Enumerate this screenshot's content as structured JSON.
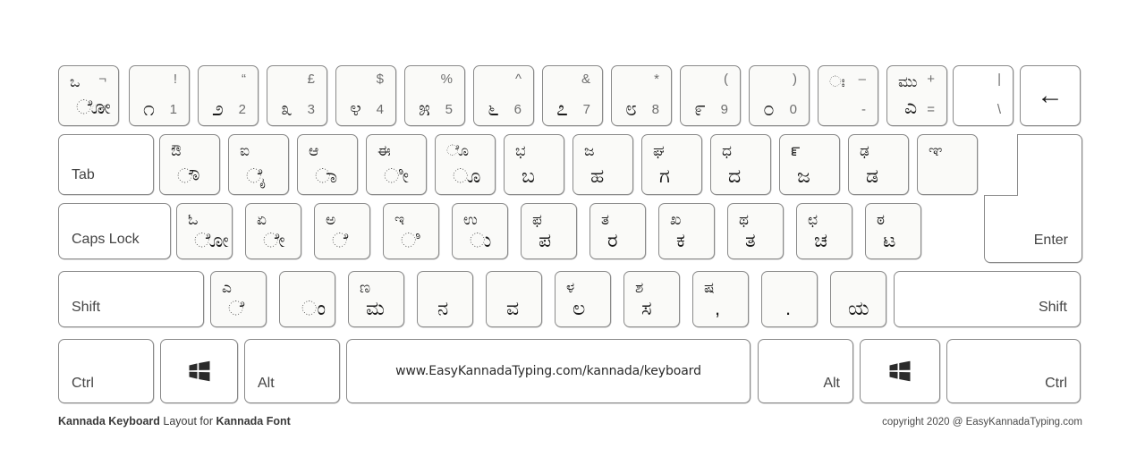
{
  "page": {
    "title": "Kannada Keyboard Layout for Kannada Font",
    "footer_left_strong1": "Kannada Keyboard",
    "footer_left_normal": " Layout for ",
    "footer_left_strong2": "Kannada Font",
    "footer_right": "copyright 2020 @ EasyKannadaTyping.com",
    "background": "#ffffff",
    "key_face": "#fafaf8",
    "key_border": "#8a8a8a",
    "glyph_color": "#1b1b1b",
    "symbol_color": "#6e6e6e"
  },
  "spacebar": {
    "label": "www.EasyKannadaTyping.com/kannada/keyboard"
  },
  "rows": {
    "number_row": [
      {
        "name": "key-backquote",
        "tl": "ಒ",
        "tr": "¬",
        "bl": "ೋ",
        "br": "್"
      },
      {
        "name": "key-1",
        "tr": "!",
        "numglyph": "೧",
        "br": "1"
      },
      {
        "name": "key-2",
        "tr": "“",
        "numglyph": "೨",
        "br": "2"
      },
      {
        "name": "key-3",
        "tr": "£",
        "numglyph": "೩",
        "br": "3"
      },
      {
        "name": "key-4",
        "tr": "$",
        "numglyph": "೪",
        "br": "4"
      },
      {
        "name": "key-5",
        "tr": "%",
        "numglyph": "೫",
        "br": "5"
      },
      {
        "name": "key-6",
        "tr": "^",
        "numglyph": "೬",
        "br": "6"
      },
      {
        "name": "key-7",
        "tr": "&",
        "numglyph": "೭",
        "br": "7"
      },
      {
        "name": "key-8",
        "tr": "*",
        "numglyph": "೮",
        "br": "8"
      },
      {
        "name": "key-9",
        "tr": "(",
        "numglyph": "೯",
        "br": "9"
      },
      {
        "name": "key-0",
        "tr": ")",
        "numglyph": "೦",
        "br": "0"
      },
      {
        "name": "key-minus",
        "tl": "ಃ",
        "tr": "–",
        "bl": "",
        "br": "-"
      },
      {
        "name": "key-equal",
        "tl": "ಮು",
        "tr": "+",
        "bl": "ಎ",
        "br": "="
      },
      {
        "name": "key-backslash",
        "tr": "|",
        "br": "\\"
      },
      {
        "name": "key-backspace",
        "icon": "backspace-arrow",
        "glyph": "←"
      }
    ],
    "tab_row": [
      {
        "name": "key-tab",
        "text": "Tab"
      },
      {
        "name": "key-q",
        "tl": "ಔ",
        "bl": "ೌ"
      },
      {
        "name": "key-w",
        "tl": "ಐ",
        "bl": "ೈ"
      },
      {
        "name": "key-e",
        "tl": "ಆ",
        "bl": "ಾ"
      },
      {
        "name": "key-r",
        "tl": "ಈ",
        "bl": "ೀ"
      },
      {
        "name": "key-t",
        "tl": "ೊ",
        "bl": "ೂ"
      },
      {
        "name": "key-y",
        "tl": "ಭ",
        "bl": "ಬ"
      },
      {
        "name": "key-u",
        "tl": "ಜ",
        "bl": "ಹ"
      },
      {
        "name": "key-i",
        "tl": "ಘ",
        "bl": "ಗ"
      },
      {
        "name": "key-o",
        "tl": "ಧ",
        "bl": "ದ"
      },
      {
        "name": "key-p",
        "tl": "ೝ",
        "bl": "ಜ"
      },
      {
        "name": "key-bracketleft",
        "tl": "ಢ",
        "bl": "ಡ"
      },
      {
        "name": "key-bracketright",
        "tl": "ಞ",
        "bl": ""
      }
    ],
    "home_row": [
      {
        "name": "key-capslock",
        "text": "Caps Lock"
      },
      {
        "name": "key-a",
        "tl": "ಓ",
        "bl": "ೋ"
      },
      {
        "name": "key-s",
        "tl": "ಏ",
        "bl": "ೇ"
      },
      {
        "name": "key-d",
        "tl": "ಅ",
        "bl": "ೆ"
      },
      {
        "name": "key-f",
        "tl": "ಇ",
        "bl": "ಿ"
      },
      {
        "name": "key-g",
        "tl": "ಉ",
        "bl": "ು"
      },
      {
        "name": "key-h",
        "tl": "ಫ",
        "bl": "ಪ"
      },
      {
        "name": "key-j",
        "tl": "ತ",
        "bl": "ರ"
      },
      {
        "name": "key-k",
        "tl": "ಖ",
        "bl": "ಕ"
      },
      {
        "name": "key-l",
        "tl": "ಥ",
        "bl": "ತ"
      },
      {
        "name": "key-semicolon",
        "tl": "ಛ",
        "bl": "ಚ"
      },
      {
        "name": "key-quote",
        "tl": "ಠ",
        "bl": "ಟ"
      }
    ],
    "shift_row": [
      {
        "name": "key-shift-left",
        "text": "Shift"
      },
      {
        "name": "key-z",
        "tl": "ಎ",
        "bl": "ೆ"
      },
      {
        "name": "key-x",
        "tl": "",
        "bl": "ಂ"
      },
      {
        "name": "key-c",
        "tl": "ಣ",
        "bl": "ಮ"
      },
      {
        "name": "key-v",
        "tl": "",
        "bl": "ನ"
      },
      {
        "name": "key-b",
        "tl": "",
        "bl": "ವ"
      },
      {
        "name": "key-n",
        "tl": "ಳ",
        "bl": "ಲ"
      },
      {
        "name": "key-m",
        "tl": "ಶ",
        "bl": "ಸ"
      },
      {
        "name": "key-comma",
        "tl": "ಷ",
        "bl": ","
      },
      {
        "name": "key-period",
        "tl": "",
        "bl": "."
      },
      {
        "name": "key-slash",
        "tl": "",
        "bl": "ಯ"
      },
      {
        "name": "key-shift-right",
        "text": "Shift"
      }
    ],
    "bottom_row": [
      {
        "name": "key-ctrl-left",
        "text": "Ctrl"
      },
      {
        "name": "key-win-left",
        "icon": "windows-logo"
      },
      {
        "name": "key-alt-left",
        "text": "Alt"
      },
      {
        "name": "key-space",
        "text": "www.EasyKannadaTyping.com/kannada/keyboard"
      },
      {
        "name": "key-alt-right",
        "text": "Alt"
      },
      {
        "name": "key-win-right",
        "icon": "windows-logo"
      },
      {
        "name": "key-ctrl-right",
        "text": "Ctrl"
      }
    ]
  },
  "enter": {
    "label": "Enter"
  }
}
